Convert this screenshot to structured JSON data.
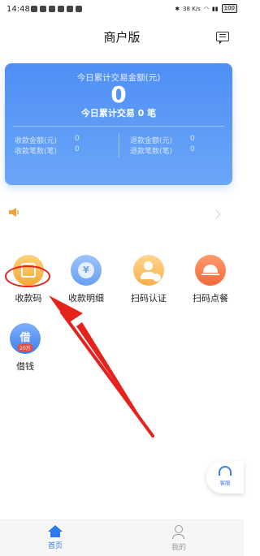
{
  "status_bar": {
    "time": "14:48",
    "net_speed": "38 K/s",
    "battery": "100"
  },
  "header": {
    "title": "商户版"
  },
  "summary": {
    "label": "今日累计交易金额(元)",
    "amount": "0",
    "count_text": "今日累计交易 0 笔",
    "collect_amount_label": "收款金额(元)",
    "collect_amount_value": "0",
    "collect_count_label": "收款笔数(笔)",
    "collect_count_value": "0",
    "refund_amount_label": "退款金额(元)",
    "refund_amount_value": "0",
    "refund_count_label": "退款笔数(笔)",
    "refund_count_value": "0"
  },
  "grid": [
    {
      "label": "收款码",
      "icon": "qr-code-icon"
    },
    {
      "label": "收款明细",
      "icon": "yuan-coin-icon"
    },
    {
      "label": "扫码认证",
      "icon": "user-verify-icon"
    },
    {
      "label": "扫码点餐",
      "icon": "food-dome-icon"
    },
    {
      "label": "借钱",
      "icon": "loan-icon",
      "tag": "20万",
      "glyph": "借"
    }
  ],
  "float_service": {
    "label": "客服"
  },
  "tabs": [
    {
      "label": "首页",
      "active": true
    },
    {
      "label": "我的",
      "active": false
    }
  ],
  "colors": {
    "accent": "#2f79f0",
    "card_top": "#4f8ff5",
    "annotation": "#e5221b"
  }
}
